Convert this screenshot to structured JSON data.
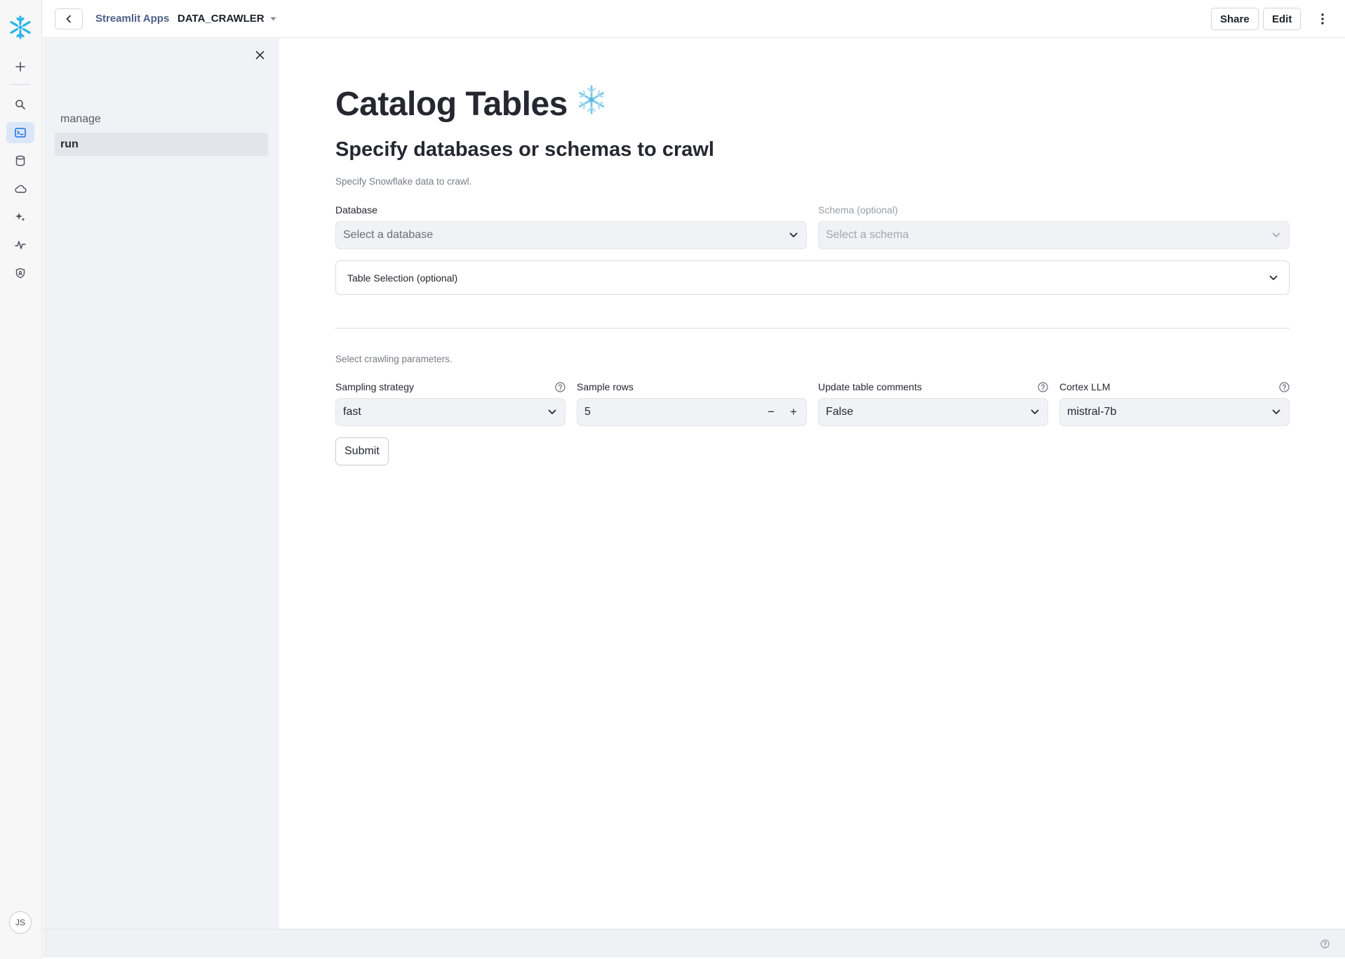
{
  "rail": {
    "icons": [
      "snowflake-logo",
      "plus-icon",
      "search-icon",
      "terminal-icon",
      "database-icon",
      "cloud-icon",
      "sparkle-icon",
      "activity-icon",
      "shield-icon"
    ],
    "avatar_initials": "JS"
  },
  "topbar": {
    "breadcrumb_link": "Streamlit Apps",
    "app_name": "DATA_CRAWLER",
    "share_label": "Share",
    "edit_label": "Edit"
  },
  "sidebar": {
    "items": [
      {
        "label": "manage",
        "active": false
      },
      {
        "label": "run",
        "active": true
      }
    ]
  },
  "main": {
    "title": "Catalog Tables",
    "title_emoji": "❄️",
    "subtitle": "Specify databases or schemas to crawl",
    "caption1": "Specify Snowflake data to crawl.",
    "database": {
      "label": "Database",
      "placeholder": "Select a database"
    },
    "schema": {
      "label": "Schema (optional)",
      "placeholder": "Select a schema"
    },
    "expander_label": "Table Selection (optional)",
    "caption2": "Select crawling parameters.",
    "params": {
      "sampling": {
        "label": "Sampling strategy",
        "value": "fast"
      },
      "rows": {
        "label": "Sample rows",
        "value": "5"
      },
      "comments": {
        "label": "Update table comments",
        "value": "False"
      },
      "llm": {
        "label": "Cortex LLM",
        "value": "mistral-7b"
      }
    },
    "submit_label": "Submit"
  },
  "colors": {
    "accent": "#1a6ce7",
    "snowflake_blue": "#29b5e8",
    "sidebar_bg": "#f0f2f6"
  }
}
